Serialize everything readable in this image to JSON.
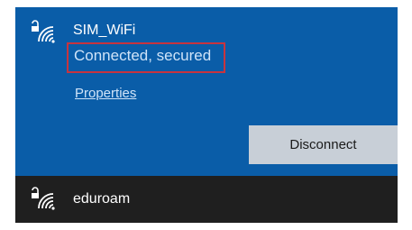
{
  "networks": {
    "active": {
      "name": "SIM_WiFi",
      "status": "Connected, secured",
      "properties_label": "Properties",
      "disconnect_label": "Disconnect",
      "icon": "wifi-secured-icon"
    },
    "other": [
      {
        "name": "eduroam",
        "icon": "wifi-secured-icon"
      }
    ]
  },
  "colors": {
    "active_background": "#0a5da8",
    "panel_background": "#1f1f1f",
    "highlight_border": "#c8343e",
    "disconnect_button": "#c8cfd7"
  }
}
